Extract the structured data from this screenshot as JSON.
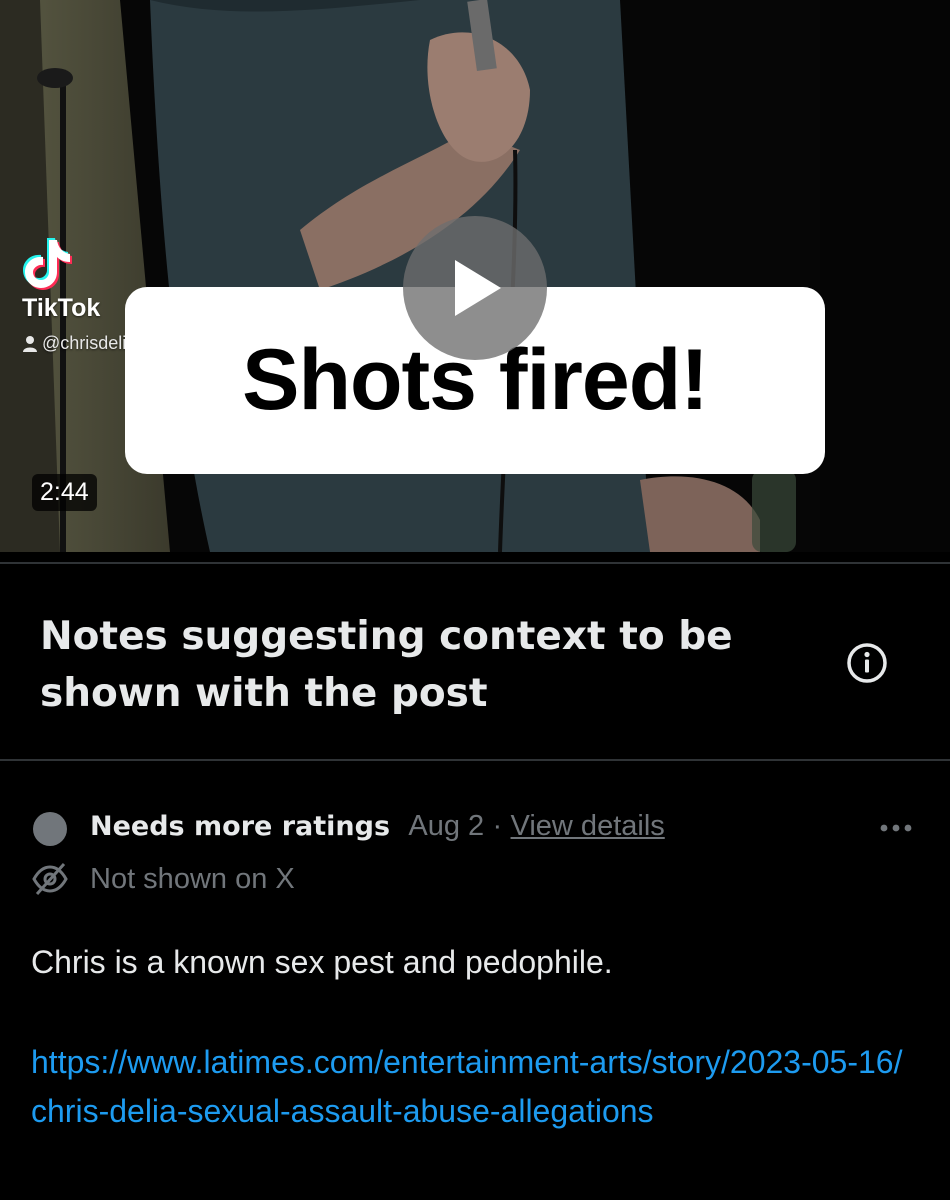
{
  "video": {
    "source_logo_label": "TikTok",
    "source_handle": "@chrisdelia",
    "caption": "Shots fired!",
    "duration": "2:44",
    "play_icon": "play-icon"
  },
  "notes_section": {
    "title": "Notes suggesting context to be shown with the post",
    "info_icon": "info-icon"
  },
  "note": {
    "status": "Needs more ratings",
    "date": "Aug 2",
    "separator": "·",
    "details_link": "View details",
    "visibility": "Not shown on X",
    "body": "Chris is a known sex pest and pedophile.",
    "url": "https://www.latimes.com/entertainment-arts/story/2023-05-16/chris-delia-sexual-assault-abuse-allegations"
  },
  "colors": {
    "background": "#000000",
    "text_primary": "#e7e9ea",
    "text_secondary": "#71767b",
    "link": "#1d9bf0",
    "divider": "#2f3336"
  }
}
